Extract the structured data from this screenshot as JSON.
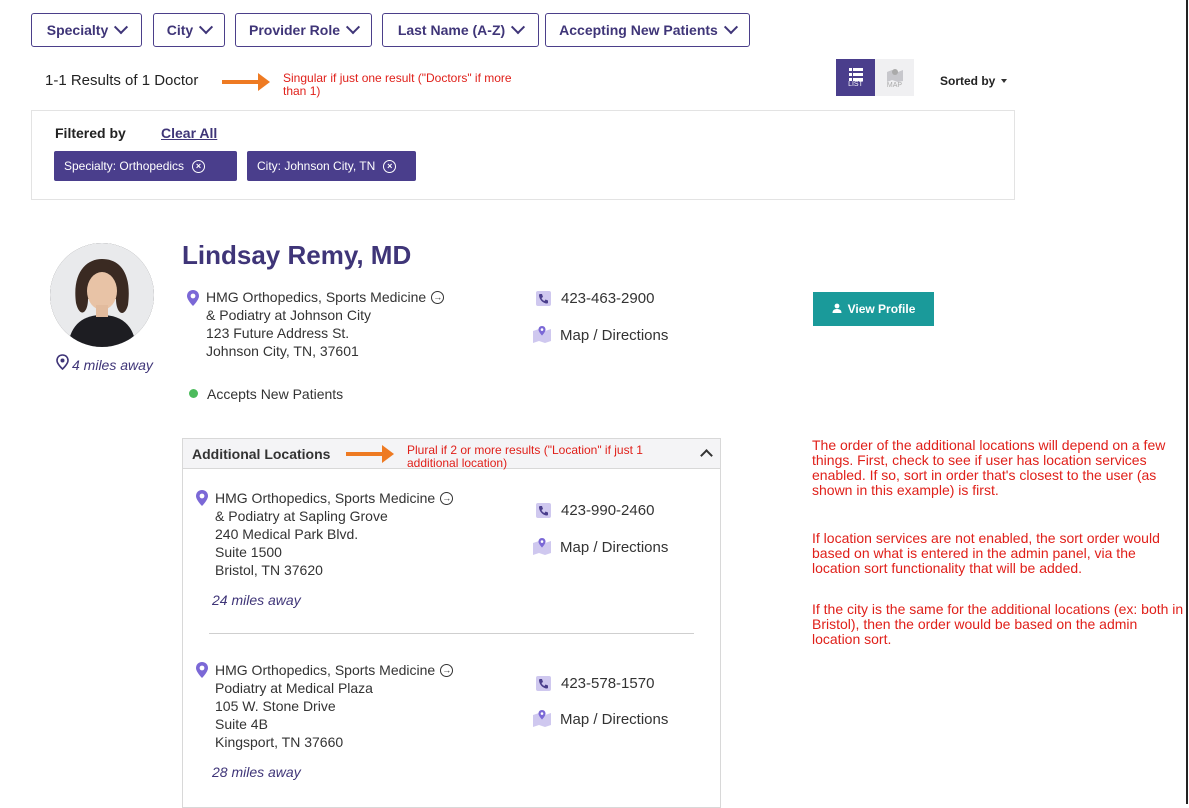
{
  "filters": {
    "specialty": "Specialty",
    "city": "City",
    "provider_role": "Provider Role",
    "last_name": "Last Name (A-Z)",
    "accepting": "Accepting New Patients"
  },
  "results": {
    "count_text": "1-1 Results of 1 Doctor",
    "list_label": "LIST",
    "map_label": "MAP",
    "sorted_by": "Sorted by"
  },
  "annotations": {
    "singular_note": "Singular if just one result (\"Doctors\" if more than 1)",
    "plural_note": "Plural if 2 or more results (\"Location\" if just 1 additional location)",
    "order_note_1": "The order of the additional locations will depend on a few things. First, check to see if user has location services enabled. If so, sort in order that's closest to the user (as shown in this example) is first.",
    "order_note_2": "If location services are not enabled, the sort order would based on what is entered in the admin panel, via the location sort functionality that will be added.",
    "order_note_3": "If the city is the same for the additional locations (ex: both in Bristol), then the order would be based on the admin location sort."
  },
  "filtered_by": {
    "label": "Filtered by",
    "clear_all": "Clear All",
    "chips": [
      "Specialty: Orthopedics",
      "City: Johnson City, TN"
    ]
  },
  "doctor": {
    "name": "Lindsay Remy, MD",
    "distance": "4 miles away",
    "location": {
      "line1": "HMG Orthopedics, Sports Medicine",
      "line2": "& Podiatry at Johnson City",
      "line3": "123 Future Address St.",
      "line4": "Johnson City, TN, 37601"
    },
    "phone": "423-463-2900",
    "map_directions": "Map / Directions",
    "accepts": "Accepts New Patients",
    "view_profile": "View Profile"
  },
  "additional": {
    "header": "Additional Locations",
    "locations": [
      {
        "line1": "HMG Orthopedics, Sports Medicine",
        "line2": "& Podiatry at Sapling Grove",
        "line3": "240 Medical Park Blvd.",
        "line4": "Suite 1500",
        "line5": "Bristol, TN 37620",
        "phone": "423-990-2460",
        "map_directions": "Map / Directions",
        "distance": "24 miles away"
      },
      {
        "line1": "HMG Orthopedics, Sports Medicine",
        "line2": "Podiatry at Medical Plaza",
        "line3": "105 W. Stone Drive",
        "line4": "Suite 4B",
        "line5": "Kingsport, TN 37660",
        "phone": "423-578-1570",
        "map_directions": "Map / Directions",
        "distance": "28 miles away"
      }
    ]
  },
  "colors": {
    "brand_purple": "#3f3578",
    "chip_purple": "#4a3e8c",
    "teal_button": "#1a9a9a",
    "annotation_red": "#e0201a",
    "arrow_orange": "#ee7a22",
    "green_status": "#4cbb5c"
  }
}
